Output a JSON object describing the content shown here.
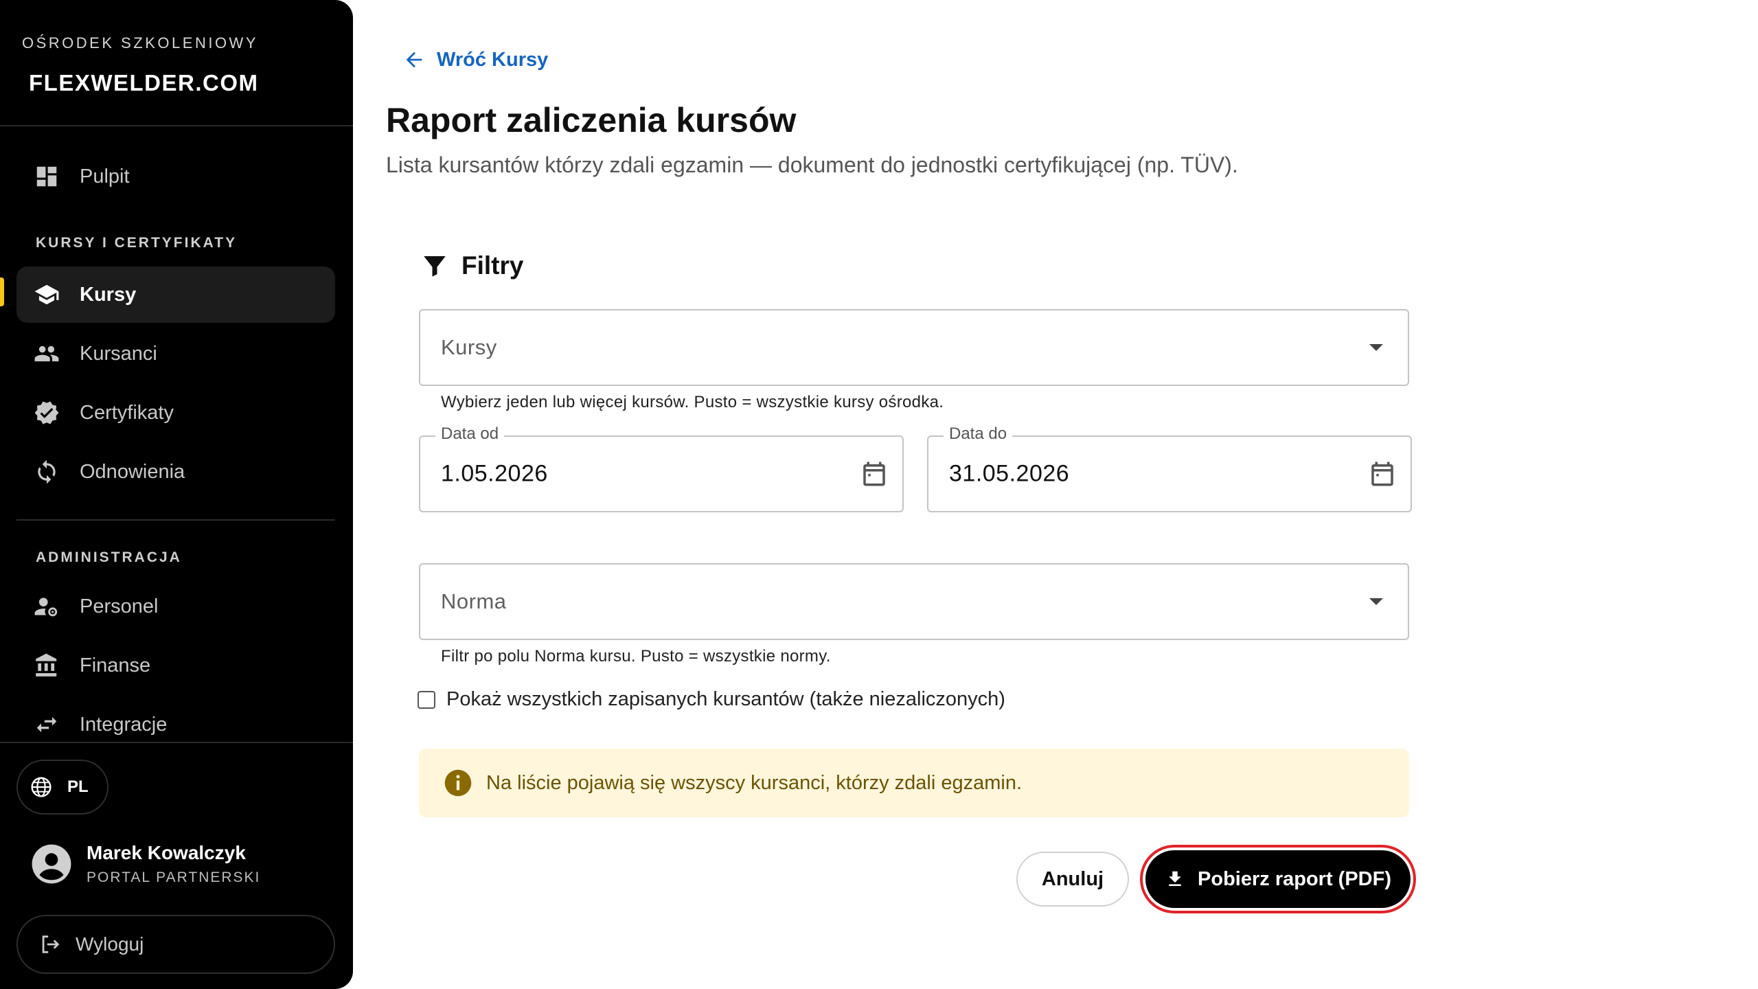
{
  "sidebar": {
    "brand_subtitle": "OŚRODEK SZKOLENIOWY",
    "brand_name": "FLEXWELDER.COM",
    "dashboard": "Pulpit",
    "section_courses": "KURSY I CERTYFIKATY",
    "courses": "Kursy",
    "trainees": "Kursanci",
    "certificates": "Certyfikaty",
    "renewals": "Odnowienia",
    "section_admin": "ADMINISTRACJA",
    "staff": "Personel",
    "finance": "Finanse",
    "integrations": "Integracje",
    "language": "PL",
    "user_name": "Marek Kowalczyk",
    "user_role": "PORTAL PARTNERSKI",
    "logout": "Wyloguj",
    "accent_color": "#f5c518"
  },
  "main": {
    "back_link": "Wróć Kursy",
    "title": "Raport zaliczenia kursów",
    "subtitle": "Lista kursantów którzy zdali egzamin — dokument do jednostki certyfikującej (np. TÜV).",
    "filters_heading": "Filtry",
    "courses_placeholder": "Kursy",
    "courses_helper": "Wybierz jeden lub więcej kursów. Pusto = wszystkie kursy ośrodka.",
    "date_from_label": "Data od",
    "date_from_value": "1.05.2026",
    "date_to_label": "Data do",
    "date_to_value": "31.05.2026",
    "norm_placeholder": "Norma",
    "norm_helper": "Filtr po polu Norma kursu. Pusto = wszystkie normy.",
    "show_all_checkbox": "Pokaż wszystkich zapisanych kursantów (także niezaliczonych)",
    "info_alert": "Na liście pojawią się wszyscy kursanci, którzy zdali egzamin.",
    "cancel_button": "Anuluj",
    "download_button": "Pobierz raport (PDF)",
    "link_color": "#1565c0",
    "highlight_color": "#e0242a"
  }
}
